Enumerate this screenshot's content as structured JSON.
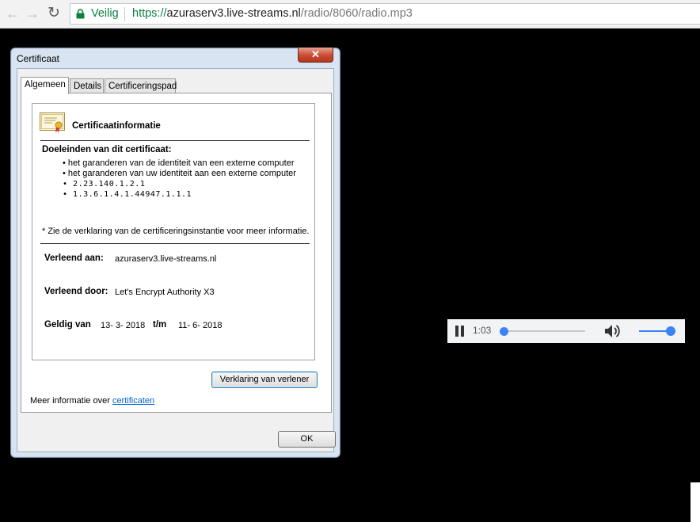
{
  "browser": {
    "secure_label": "Veilig",
    "url_scheme": "https://",
    "url_host": "azuraserv3.live-streams.nl",
    "url_path": "/radio/8060/radio.mp3",
    "back_glyph": "←",
    "forward_glyph": "→",
    "reload_glyph": "↻",
    "accent_secure": "#0b8043"
  },
  "player": {
    "time": "1:03",
    "seek_progress": 0.02,
    "volume_level": 1.0,
    "accent": "#3b82f6"
  },
  "dialog": {
    "title": "Certificaat",
    "close_glyph": "✕",
    "tabs": [
      {
        "label": "Algemeen",
        "active": true
      },
      {
        "label": "Details",
        "active": false
      },
      {
        "label": "Certificeringspad",
        "active": false
      }
    ],
    "header_title": "Certificaatinformatie",
    "purposes_heading": "Doeleinden van dit certificaat:",
    "purposes": [
      "het garanderen van de identiteit van een externe computer",
      "het garanderen van uw identiteit aan een externe computer",
      "2.23.140.1.2.1",
      "1.3.6.1.4.1.44947.1.1.1"
    ],
    "note": "* Zie de verklaring van de certificeringsinstantie voor meer informatie.",
    "issued_to_label": "Verleend aan:",
    "issued_to_value": "azuraserv3.live-streams.nl",
    "issued_by_label": "Verleend door:",
    "issued_by_value": "Let's Encrypt Authority X3",
    "valid_from_label": "Geldig van",
    "valid_from_value": "13- 3- 2018",
    "valid_to_label": "t/m",
    "valid_to_value": "11- 6- 2018",
    "issuer_statement_button": "Verklaring van verlener",
    "more_info_text": "Meer informatie over ",
    "more_info_link": "certificaten",
    "ok_button": "OK"
  }
}
